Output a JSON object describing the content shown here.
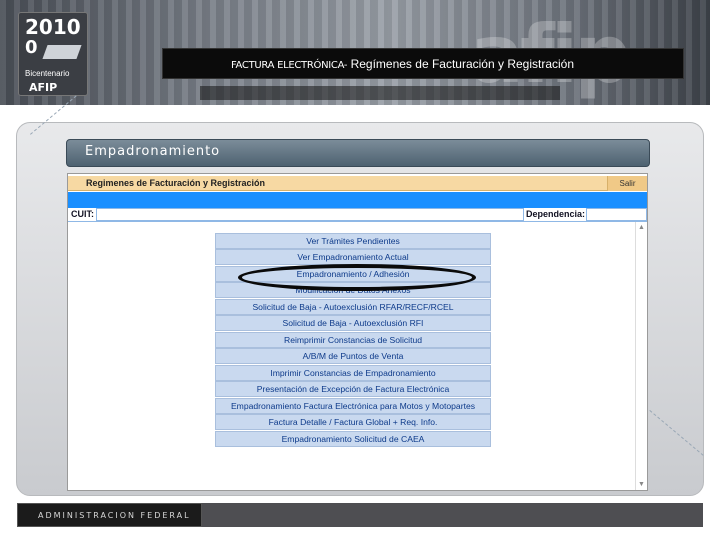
{
  "banner": {
    "title_strong": "FACTURA ELECTRÓNICA-",
    "title_rest": " Regímenes de Facturación y Registración",
    "logo": {
      "year": "2010",
      "number": "0",
      "subtitle": "Bicentenario",
      "mark": "AFIP"
    }
  },
  "section": {
    "header": "Empadronamiento"
  },
  "app": {
    "title": "Regimenes de Facturación y Registración",
    "exit_label": "Salir",
    "cuit_label": "CUIT:",
    "dependencia_label": "Dependencia:",
    "menu": [
      {
        "label": "Ver Trámites Pendientes"
      },
      {
        "label": "Ver Empadronamiento Actual"
      },
      {
        "label": "Empadronamiento / Adhesión"
      },
      {
        "label": "Modificación de Datos Anexos"
      },
      {
        "label": "Solicitud de Baja - Autoexclusión RFAR/RECF/RCEL"
      },
      {
        "label": "Solicitud de Baja - Autoexclusión RFI"
      },
      {
        "label": "Reimprimir Constancias de Solicitud"
      },
      {
        "label": "A/B/M de Puntos de Venta"
      },
      {
        "label": "Imprimir Constancias de Empadronamiento"
      },
      {
        "label": "Presentación de Excepción de Factura Electrónica"
      },
      {
        "label": "Empadronamiento Factura Electrónica para Motos y Motopartes"
      },
      {
        "label": "Factura Detalle / Factura Global + Req. Info."
      },
      {
        "label": "Empadronamiento Solicitud de CAEA"
      }
    ]
  },
  "footer": {
    "label": "ADMINISTRACION FEDERAL"
  },
  "colors": {
    "menu_item_bg": "#c9d9ef",
    "menu_text": "#0d3a8a",
    "titlebar": "#f7d9a3",
    "bluebar": "#1a8fff",
    "section_header": "#5a6d7c"
  }
}
